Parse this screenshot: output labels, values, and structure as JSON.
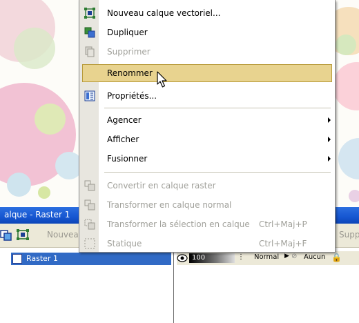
{
  "menu": {
    "items": [
      {
        "label": "Nouveau calque vectoriel...",
        "icon": "vector-layer-icon",
        "enabled": true
      },
      {
        "label": "Dupliquer",
        "icon": "duplicate-icon",
        "enabled": true
      },
      {
        "label": "Supprimer",
        "icon": "delete-icon",
        "enabled": false
      },
      {
        "label": "Renommer",
        "icon": "",
        "enabled": true,
        "highlighted": true
      },
      {
        "label": "Propriétés...",
        "icon": "properties-icon",
        "enabled": true
      },
      {
        "label": "Agencer",
        "submenu": true,
        "enabled": true
      },
      {
        "label": "Afficher",
        "submenu": true,
        "enabled": true
      },
      {
        "label": "Fusionner",
        "submenu": true,
        "enabled": true
      },
      {
        "label": "Convertir en calque raster",
        "icon": "convert-raster-icon",
        "enabled": false
      },
      {
        "label": "Transformer en calque normal",
        "icon": "transform-normal-icon",
        "enabled": false
      },
      {
        "label": "Transformer la sélection en calque",
        "shortcut": "Ctrl+Maj+P",
        "icon": "selection-to-layer-icon",
        "enabled": false
      },
      {
        "label": "Statique",
        "shortcut": "Ctrl+Maj+F",
        "icon": "static-icon",
        "enabled": false
      }
    ]
  },
  "panel": {
    "title": "alque - Raster 1",
    "toolbar_new_label": "Nouvea",
    "toolbar_delete_label": "Supp",
    "layer_name": "Raster 1",
    "opacity": "100",
    "blend_mode": "Normal",
    "lock_label": "Aucun"
  },
  "colors": {
    "highlight": "#e8d38f",
    "titlebar": "#1656d1",
    "selected_layer": "#316ac5"
  }
}
